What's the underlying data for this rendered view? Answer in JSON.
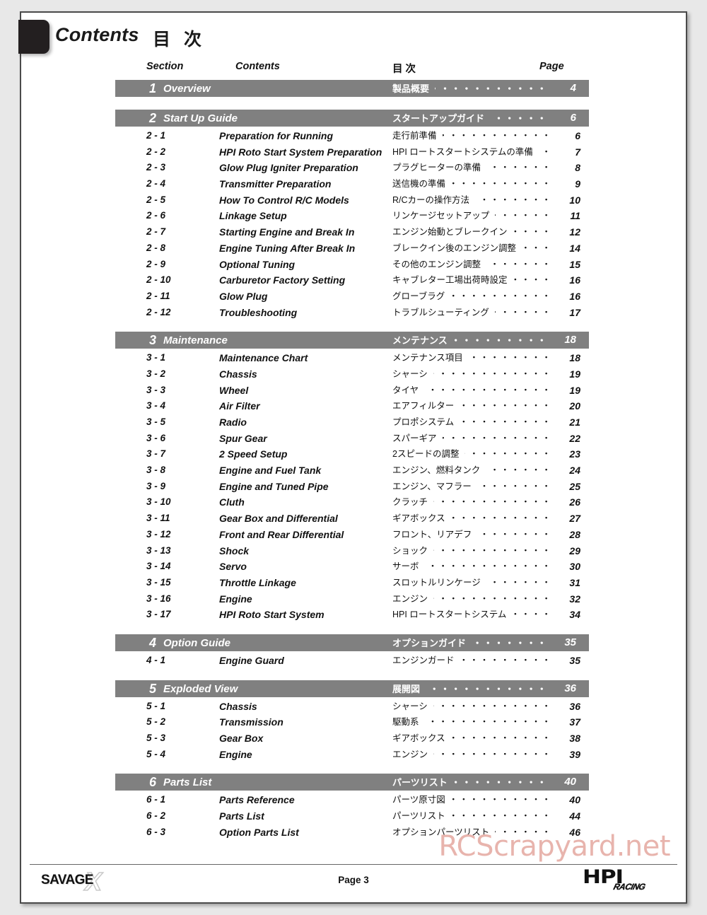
{
  "header": {
    "title_en": "Contents",
    "title_jp": "目 次"
  },
  "columns": {
    "section": "Section",
    "contents": "Contents",
    "jp": "目 次",
    "page": "Page"
  },
  "sections": [
    {
      "num": "1",
      "en": "Overview",
      "jp": "製品概要",
      "page": "4",
      "entries": []
    },
    {
      "num": "2",
      "en": "Start Up Guide",
      "jp": "スタートアップガイド",
      "page": "6",
      "entries": [
        {
          "num": "2 - 1",
          "en": "Preparation for Running",
          "jp": "走行前準備",
          "page": "6"
        },
        {
          "num": "2 - 2",
          "en": "HPI Roto Start System Preparation",
          "jp": "HPI ロートスタートシステムの準備",
          "page": "7"
        },
        {
          "num": "2 - 3",
          "en": "Glow Plug Igniter Preparation",
          "jp": "プラグヒーターの準備",
          "page": "8"
        },
        {
          "num": "2 - 4",
          "en": "Transmitter Preparation",
          "jp": "送信機の準備",
          "page": "9"
        },
        {
          "num": "2 - 5",
          "en": "How To Control R/C Models",
          "jp": "R/Cカーの操作方法",
          "page": "10"
        },
        {
          "num": "2 - 6",
          "en": "Linkage Setup",
          "jp": "リンケージセットアップ",
          "page": "11"
        },
        {
          "num": "2 - 7",
          "en": "Starting Engine and Break In",
          "jp": "エンジン始動とブレークイン",
          "page": "12"
        },
        {
          "num": "2 - 8",
          "en": "Engine Tuning After Break In",
          "jp": "ブレークイン後のエンジン調整",
          "page": "14"
        },
        {
          "num": "2 - 9",
          "en": "Optional Tuning",
          "jp": "その他のエンジン調整",
          "page": "15"
        },
        {
          "num": "2 - 10",
          "en": "Carburetor Factory Setting",
          "jp": "キャブレター工場出荷時設定",
          "page": "16"
        },
        {
          "num": "2 - 11",
          "en": "Glow Plug",
          "jp": "グローブラグ",
          "page": "16"
        },
        {
          "num": "2 - 12",
          "en": "Troubleshooting",
          "jp": "トラブルシューティング",
          "page": "17"
        }
      ]
    },
    {
      "num": "3",
      "en": "Maintenance",
      "jp": "メンテナンス",
      "page": "18",
      "entries": [
        {
          "num": "3 - 1",
          "en": "Maintenance Chart",
          "jp": "メンテナンス項目",
          "page": "18"
        },
        {
          "num": "3 - 2",
          "en": "Chassis",
          "jp": "シャーシ",
          "page": "19"
        },
        {
          "num": "3 - 3",
          "en": "Wheel",
          "jp": "タイヤ",
          "page": "19"
        },
        {
          "num": "3 - 4",
          "en": "Air Filter",
          "jp": "エアフィルター",
          "page": "20"
        },
        {
          "num": "3 - 5",
          "en": "Radio",
          "jp": "プロポシステム",
          "page": "21"
        },
        {
          "num": "3 - 6",
          "en": "Spur Gear",
          "jp": "スパーギア",
          "page": "22"
        },
        {
          "num": "3 - 7",
          "en": "2 Speed Setup",
          "jp": "2スピードの調整",
          "page": "23"
        },
        {
          "num": "3 - 8",
          "en": "Engine and Fuel Tank",
          "jp": "エンジン、燃料タンク",
          "page": "24"
        },
        {
          "num": "3 - 9",
          "en": "Engine and Tuned Pipe",
          "jp": "エンジン、マフラー",
          "page": "25"
        },
        {
          "num": "3 - 10",
          "en": "Cluth",
          "jp": "クラッチ",
          "page": "26"
        },
        {
          "num": "3 - 11",
          "en": "Gear Box and Differential",
          "jp": "ギアボックス",
          "page": "27"
        },
        {
          "num": "3 - 12",
          "en": "Front and Rear Differential",
          "jp": "フロント、リアデフ",
          "page": "28"
        },
        {
          "num": "3 - 13",
          "en": "Shock",
          "jp": "ショック",
          "page": "29"
        },
        {
          "num": "3 - 14",
          "en": "Servo",
          "jp": "サーボ",
          "page": "30"
        },
        {
          "num": "3 - 15",
          "en": "Throttle Linkage",
          "jp": "スロットルリンケージ",
          "page": "31"
        },
        {
          "num": "3 - 16",
          "en": "Engine",
          "jp": "エンジン",
          "page": "32"
        },
        {
          "num": "3 - 17",
          "en": "HPI Roto Start System",
          "jp": "HPI ロートスタートシステム",
          "page": "34"
        }
      ]
    },
    {
      "num": "4",
      "en": "Option Guide",
      "jp": "オプションガイド",
      "page": "35",
      "entries": [
        {
          "num": "4 - 1",
          "en": "Engine Guard",
          "jp": "エンジンガード",
          "page": "35"
        }
      ]
    },
    {
      "num": "5",
      "en": "Exploded View",
      "jp": "展開図",
      "page": "36",
      "entries": [
        {
          "num": "5 - 1",
          "en": "Chassis",
          "jp": "シャーシ",
          "page": "36"
        },
        {
          "num": "5 - 2",
          "en": "Transmission",
          "jp": "駆動系",
          "page": "37"
        },
        {
          "num": "5 - 3",
          "en": "Gear Box",
          "jp": "ギアボックス",
          "page": "38"
        },
        {
          "num": "5 - 4",
          "en": "Engine",
          "jp": "エンジン",
          "page": "39"
        }
      ]
    },
    {
      "num": "6",
      "en": "Parts List",
      "jp": "パーツリスト",
      "page": "40",
      "entries": [
        {
          "num": "6 - 1",
          "en": "Parts Reference",
          "jp": "パーツ原寸図",
          "page": "40"
        },
        {
          "num": "6 - 2",
          "en": "Parts List",
          "jp": "パーツリスト",
          "page": "44"
        },
        {
          "num": "6 - 3",
          "en": "Option Parts List",
          "jp": "オプションパーツリスト",
          "page": "46"
        }
      ]
    }
  ],
  "footer": {
    "brand_name": "SAVAGE",
    "brand_mark": "X",
    "page_label": "Page 3",
    "publisher": "HPI",
    "publisher_sub": "RACING"
  },
  "watermark": {
    "text": "RCScrapyard.net",
    "color": "#e8b4ad"
  },
  "colors": {
    "section_bar": "#808080",
    "section_bar_text": "#ffffff",
    "text": "#111111",
    "page_background": "#e8e8e8",
    "sheet": "#ffffff"
  }
}
